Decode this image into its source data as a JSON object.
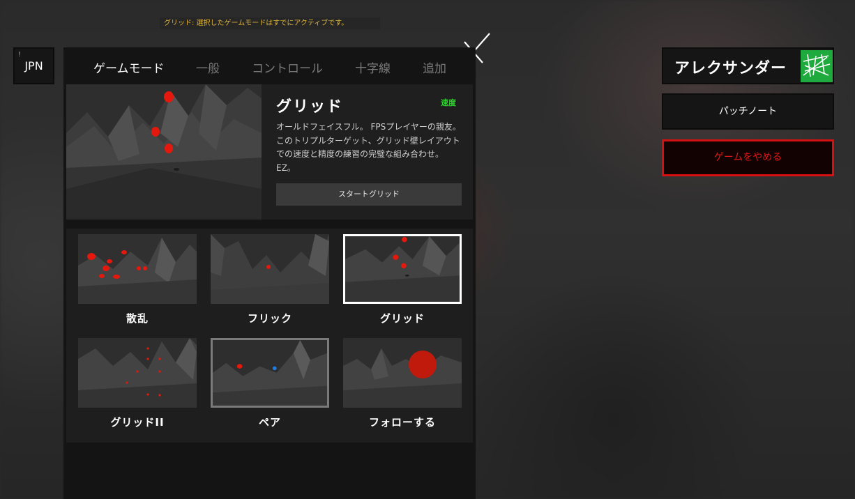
{
  "notice": "グリッド: 選択したゲームモードはすでにアクティブです。",
  "language": {
    "label": "JPN",
    "marker": "!"
  },
  "tabs": [
    {
      "label": "ゲームモード",
      "active": true
    },
    {
      "label": "一般",
      "active": false
    },
    {
      "label": "コントロール",
      "active": false
    },
    {
      "label": "十字線",
      "active": false
    },
    {
      "label": "追加",
      "active": false
    }
  ],
  "featured": {
    "title": "グリッド",
    "badge": "速度",
    "description": "オールドフェイスフル。 FPSプレイヤーの親友。このトリプルターゲット、グリッド壁レイアウトでの速度と精度の練習の完璧な組み合わせ。 EZ。",
    "start_label": "スタートグリッド"
  },
  "modes": [
    {
      "label": "散乱",
      "state": "normal"
    },
    {
      "label": "フリック",
      "state": "normal"
    },
    {
      "label": "グリッド",
      "state": "selected"
    },
    {
      "label": "グリッドII",
      "state": "normal"
    },
    {
      "label": "ペア",
      "state": "hover"
    },
    {
      "label": "フォローする",
      "state": "normal"
    }
  ],
  "player": {
    "name": "アレクサンダー"
  },
  "menu": {
    "patch_notes": "パッチノート",
    "quit": "ゲームをやめる"
  },
  "colors": {
    "target_red": "#e4180c",
    "speed_badge": "#2fd12f",
    "notice_text": "#e0b53a",
    "quit_border": "#d61010",
    "avatar_bg": "#1eaa3c",
    "pair_blue": "#1e7de0"
  }
}
